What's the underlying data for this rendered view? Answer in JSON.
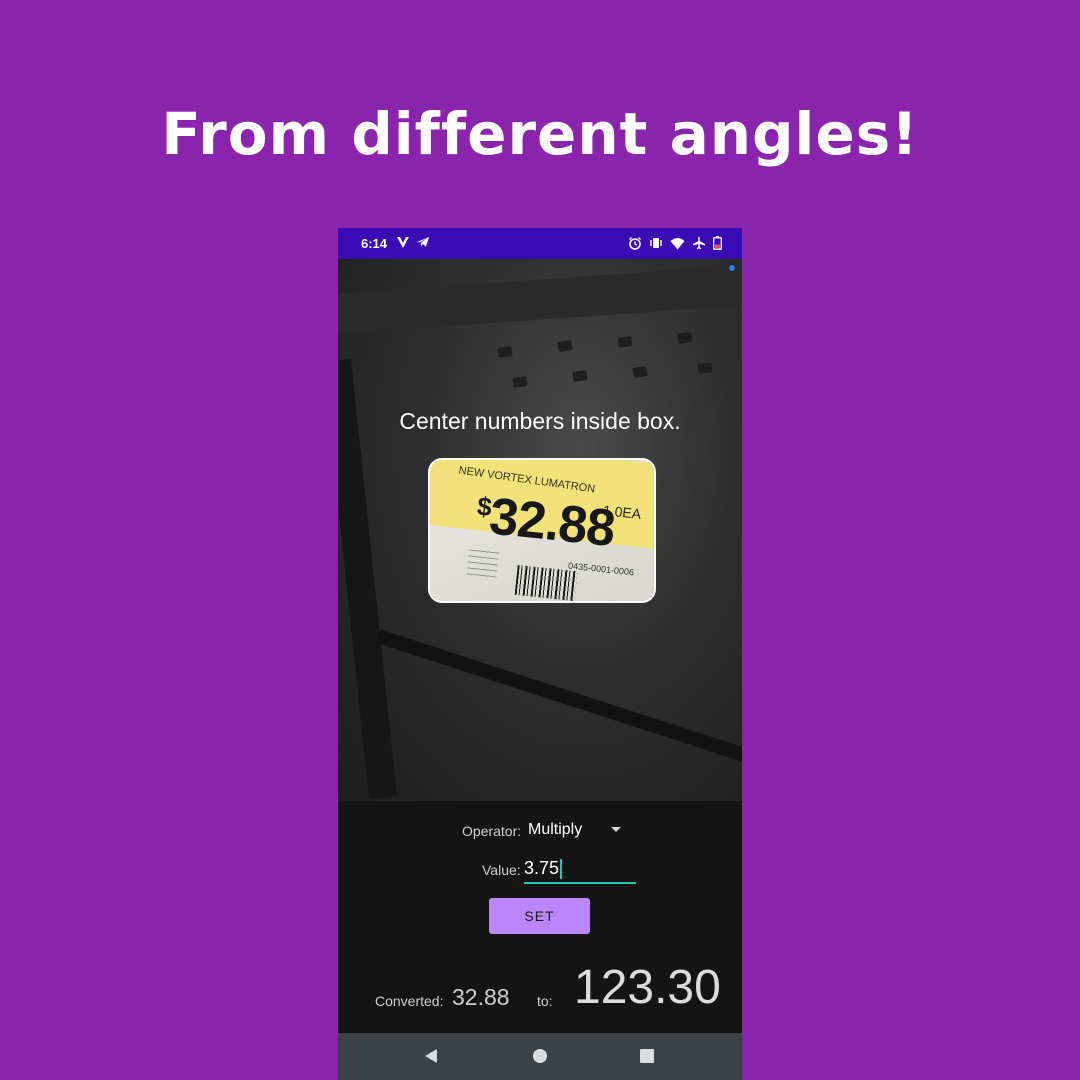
{
  "headline": "From different angles!",
  "status_bar": {
    "time": "6:14",
    "left_icons": [
      "vpn-v-icon",
      "telegram-icon"
    ],
    "right_icons": [
      "alarm-icon",
      "vibrate-icon",
      "wifi-icon",
      "airplane-icon",
      "battery-low-icon"
    ]
  },
  "camera": {
    "instruction": "Center numbers inside box.",
    "price_tag": {
      "brand_text": "NEW VORTEX LUMATRON",
      "currency": "$",
      "price": "32.88",
      "unit": "1.0EA",
      "code": "0435-0001-0006"
    }
  },
  "controls": {
    "operator_label": "Operator:",
    "operator_value": "Multiply",
    "value_label": "Value:",
    "value_input": "3.75",
    "set_button": "SET",
    "converted_label": "Converted:",
    "converted_value": "32.88",
    "to_label": "to:",
    "result_value": "123.30"
  },
  "colors": {
    "background": "#8a24ac",
    "status_bar": "#3a0bb5",
    "accent_button": "#bb86fc",
    "input_underline": "#20c8b0"
  }
}
